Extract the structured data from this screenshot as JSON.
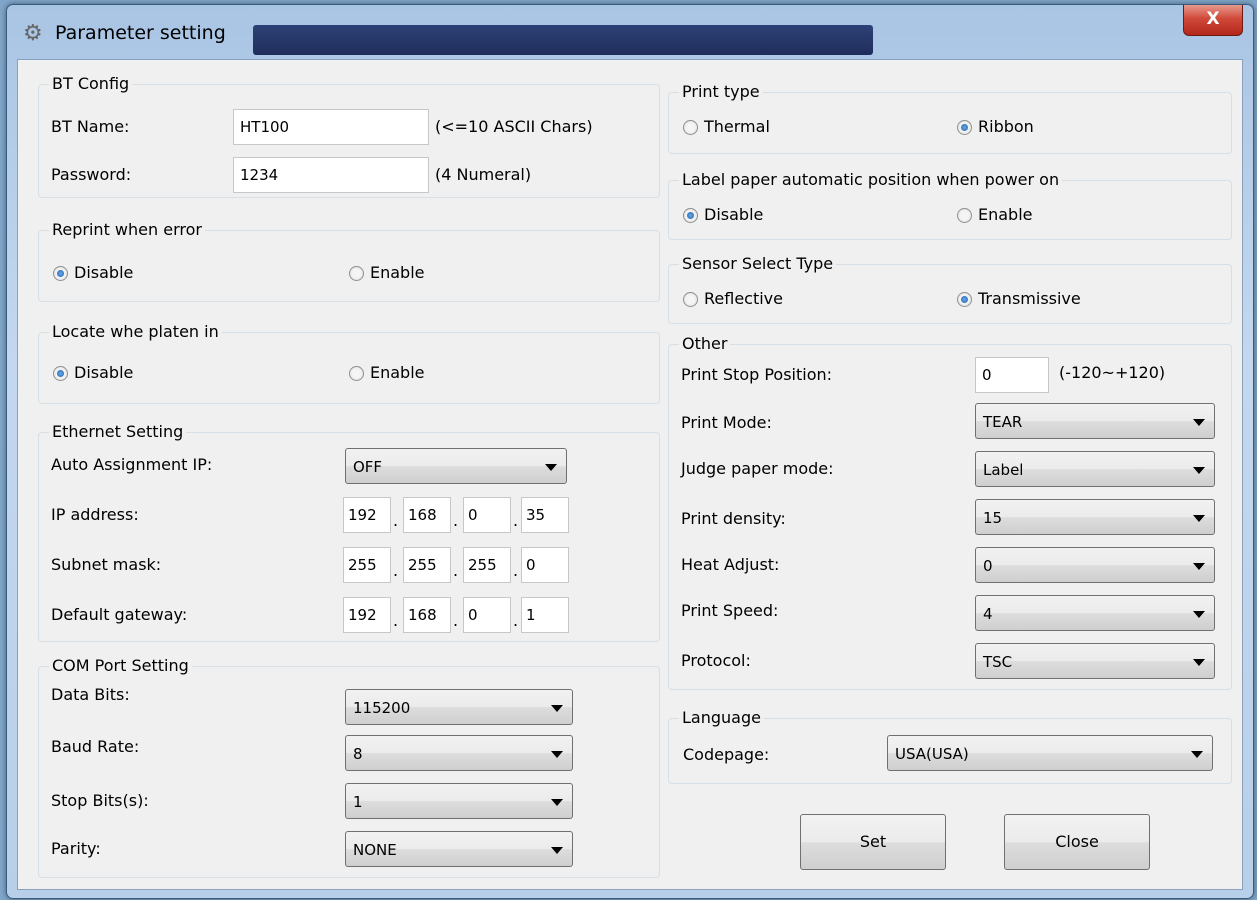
{
  "window": {
    "title": "Parameter setting",
    "close_label": "X"
  },
  "bt_config": {
    "legend": "BT Config",
    "name_label": "BT Name:",
    "name_value": "HT100",
    "name_hint": "(<=10 ASCII Chars)",
    "password_label": "Password:",
    "password_value": "1234",
    "password_hint": "(4 Numeral)"
  },
  "reprint": {
    "legend": "Reprint when error",
    "disable": "Disable",
    "enable": "Enable",
    "selected": "Disable"
  },
  "locate": {
    "legend": "Locate whe platen in",
    "disable": "Disable",
    "enable": "Enable",
    "selected": "Disable"
  },
  "ethernet": {
    "legend": "Ethernet Setting",
    "auto_label": "Auto Assignment IP:",
    "auto_value": "OFF",
    "ip_label": "IP address:",
    "ip": [
      "192",
      "168",
      "0",
      "35"
    ],
    "subnet_label": "Subnet mask:",
    "subnet": [
      "255",
      "255",
      "255",
      "0"
    ],
    "gateway_label": "Default gateway:",
    "gateway": [
      "192",
      "168",
      "0",
      "1"
    ],
    "separator": "."
  },
  "com": {
    "legend": "COM Port Setting",
    "data_bits_label": "Data Bits:",
    "data_bits_value": "115200",
    "baud_label": "Baud Rate:",
    "baud_value": "8",
    "stop_label": "Stop Bits(s):",
    "stop_value": "1",
    "parity_label": "Parity:",
    "parity_value": "NONE"
  },
  "print_type": {
    "legend": "Print type",
    "thermal": "Thermal",
    "ribbon": "Ribbon",
    "selected": "Ribbon"
  },
  "auto_position": {
    "legend": "Label paper automatic position when power on",
    "disable": "Disable",
    "enable": "Enable",
    "selected": "Disable"
  },
  "sensor": {
    "legend": "Sensor Select Type",
    "reflective": "Reflective",
    "transmissive": "Transmissive",
    "selected": "Transmissive"
  },
  "other": {
    "legend": "Other",
    "stop_pos_label": "Print Stop Position:",
    "stop_pos_value": "0",
    "stop_pos_hint": "(-120~+120)",
    "mode_label": "Print Mode:",
    "mode_value": "TEAR",
    "judge_label": "Judge paper mode:",
    "judge_value": "Label",
    "density_label": "Print density:",
    "density_value": "15",
    "heat_label": "Heat Adjust:",
    "heat_value": "0",
    "speed_label": "Print Speed:",
    "speed_value": "4",
    "protocol_label": "Protocol:",
    "protocol_value": "TSC"
  },
  "language": {
    "legend": "Language",
    "codepage_label": "Codepage:",
    "codepage_value": "USA(USA)"
  },
  "buttons": {
    "set": "Set",
    "close": "Close"
  }
}
